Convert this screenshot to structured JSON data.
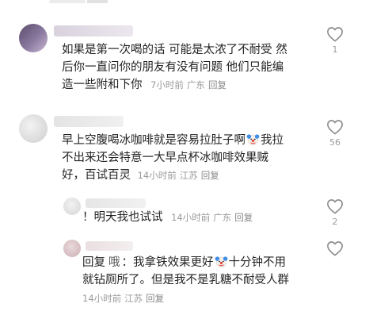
{
  "comments": [
    {
      "text_lines": [
        "如果是第一次喝的话 可能是太浓了不耐受 然",
        "后你一直问你的朋友有没有问题 他们只能编",
        "造一些附和下你"
      ],
      "time": "7小时前",
      "location": "广东",
      "reply_label": "回复",
      "likes": "1"
    },
    {
      "text_lines": [
        "早上空腹喝冰咖啡就是容易拉肚子啊",
        "我拉",
        "不出来还会特意一大早点杯冰咖啡效果贼",
        "好，百试百灵"
      ],
      "time": "14小时前",
      "location": "江苏",
      "reply_label": "回复",
      "likes": "56"
    }
  ],
  "replies": [
    {
      "text": "！明天我也试试",
      "time": "14小时前",
      "location": "广东",
      "reply_label": "回复",
      "likes": "2"
    },
    {
      "prefix": "回复",
      "at_name": "哦",
      "text_line1_a": "：我拿铁效果更好",
      "text_line1_b": "十分钟不用",
      "text_line2": "就钻厕所了。但是我不是乳糖不耐受人群",
      "time": "14小时前",
      "location": "江苏",
      "reply_label": "回复",
      "likes": ""
    }
  ],
  "icons": {
    "like": "heart-outline-icon",
    "emoji": "clown-face-emoji"
  },
  "colors": {
    "text": "#232323",
    "meta": "#9a9a9a",
    "icon": "#8c8c8c"
  }
}
